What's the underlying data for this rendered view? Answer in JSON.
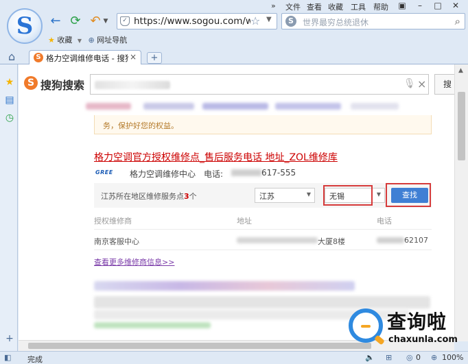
{
  "menu": [
    "文件",
    "查看",
    "收藏",
    "工具",
    "帮助"
  ],
  "menu_extra": "»",
  "address_bar": {
    "url": "https://www.sogou.com/we"
  },
  "search_box": {
    "placeholder": "世界最穷总统退休"
  },
  "bookmarks": {
    "favorites": "收藏",
    "nav": "网址导航"
  },
  "tab": {
    "title": "格力空调维修电话 - 搜狗",
    "close": "×",
    "new": "+"
  },
  "page": {
    "logo_text": "搜狗搜索",
    "search_button": "搜",
    "notice": "务，保护好您的权益。",
    "result_title": "格力空调官方授权维修点_售后服务电话 地址_ZOL维修库",
    "brand": "GREE",
    "center_name": "格力空调维修中心",
    "phone_label": "电话:",
    "phone_value": "617-555",
    "filter": {
      "prefix": "江苏所在地区维修服务点",
      "count": "3",
      "suffix": "个",
      "province": "江苏",
      "city": "无锡",
      "button": "查找"
    },
    "table": {
      "headers": [
        "授权维修商",
        "地址",
        "电话"
      ],
      "row": {
        "name": "南京客服中心",
        "address_tail": "大厦8楼",
        "phone_tail": "62107"
      }
    },
    "more_link": "查看更多维修商信息>>"
  },
  "watermark": {
    "big": "查询啦",
    "small": "chaxunla.com"
  },
  "status": {
    "text": "完成",
    "zero": "0",
    "zoom": "100%"
  }
}
